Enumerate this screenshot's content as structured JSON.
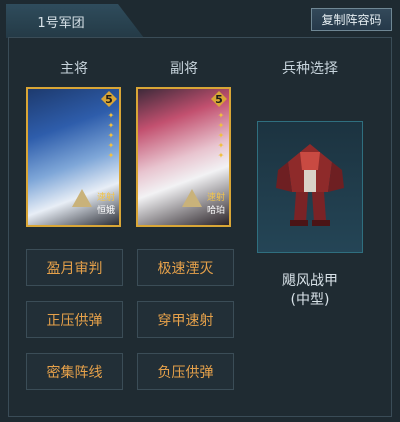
{
  "tab": {
    "label": "1号军团"
  },
  "toolbar": {
    "copy_label": "复制阵容码"
  },
  "headers": {
    "main": "主将",
    "deputy": "副将",
    "unit": "兵种选择"
  },
  "cards": [
    {
      "level": "5",
      "role": "速射",
      "name": "恒娥"
    },
    {
      "level": "5",
      "role": "速射",
      "name": "哈珀"
    }
  ],
  "unit": {
    "name": "飓风战甲",
    "type": "(中型)",
    "icon": "mech-icon"
  },
  "skills": [
    [
      "盈月审判",
      "极速湮灭"
    ],
    [
      "正压供弹",
      "穿甲速射"
    ],
    [
      "密集阵线",
      "负压供弹"
    ]
  ],
  "colors": {
    "skill_text": "#e6a14a",
    "card_border": "#d9a636",
    "accent": "#2f6f7f"
  }
}
